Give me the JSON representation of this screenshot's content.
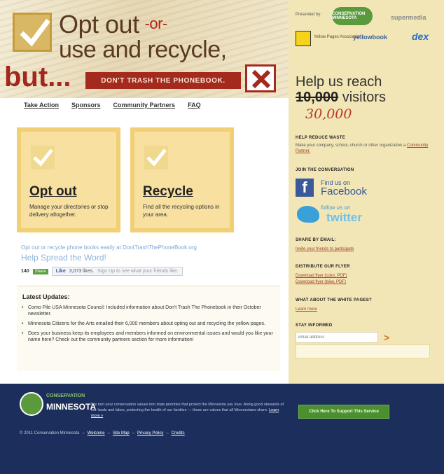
{
  "header": {
    "line1": "Opt out",
    "or": "-or-",
    "line2": "use and recycle,",
    "but": "but...",
    "banner": "DON'T TRASH THE PHONEBOOK."
  },
  "nav": [
    "Take Action",
    "Sponsors",
    "Community Partners",
    "FAQ"
  ],
  "cards": [
    {
      "title": "Opt out",
      "desc": "Manage your directories or stop delivery altogether."
    },
    {
      "title": "Recycle",
      "desc": "Find all the recycling options in your area."
    }
  ],
  "spread": {
    "top": "Opt out or recycle phone books easily at DontTrashThePhoneBook.org",
    "headline": "Help Spread the Word!",
    "count": "140",
    "share_btn": "Share",
    "fb_like": "Like",
    "fb_count": "3,073 likes.",
    "fb_note": "Sign Up to see what your friends like."
  },
  "updates": {
    "title": "Latest Updates:",
    "items": [
      "Como Pile USA Minnesota Council: Included information about Don't Trash The Phonebook in their October newsletter.",
      "Minnesota Citizens for the Arts emailed their 6,000 members about opting out and recycling the yellow pages.",
      "Does your business keep its employees and members informed on environmental issues and would you like your name here? Check out the community partners section for more information!"
    ]
  },
  "sidebar": {
    "powered": "Presented by:",
    "logo_cm": "CONSERVATION MINNESOTA",
    "logo_sm": "supermedia",
    "logo_yp": "Yellow Pages Association",
    "logo_yb": "yellowbook",
    "logo_dex": "dex",
    "help1": "Help us reach",
    "help_old": "10,000",
    "help2": "visitors",
    "help_new": "30,000",
    "reduce_head": "HELP REDUCE WASTE",
    "reduce_text": "Make your company, school, church or other organization a",
    "reduce_link": "Community Partner.",
    "join_head": "JOIN THE CONVERSATION",
    "fb_find": "Find us on",
    "fb_name": "Facebook",
    "tw_follow": "follow us on",
    "tw_name": "twitter",
    "share_head": "SHARE BY EMAIL:",
    "share_link": "Invite your friends to participate",
    "flyer_head": "DISTRIBUTE OUR FLYER",
    "flyer_link1": "Download flyer (color, PDF)",
    "flyer_link2": "Download flyer (b&w, PDF)",
    "white_head": "WHAT ABOUT THE WHITE PAGES?",
    "white_link": "Learn more",
    "stay_head": "STAY INFORMED",
    "email_placeholder": "email address",
    "submit": ">"
  },
  "footer": {
    "logo_top": "CONSERVATION",
    "logo_name": "MINNESOTA",
    "text": "We turn your conservation values into state priorities that protect the Minnesota you love. Along good stewards of our lands and lakes, protecting the health of our families — these are values that all Minnesotans share.",
    "learn": "Learn more »",
    "button": "Click Here To Support This Service",
    "copyright": "© 2011 Conservation Minnesota",
    "links": [
      "Welcome",
      "Site Map",
      "Privacy Policy",
      "Credits"
    ]
  }
}
